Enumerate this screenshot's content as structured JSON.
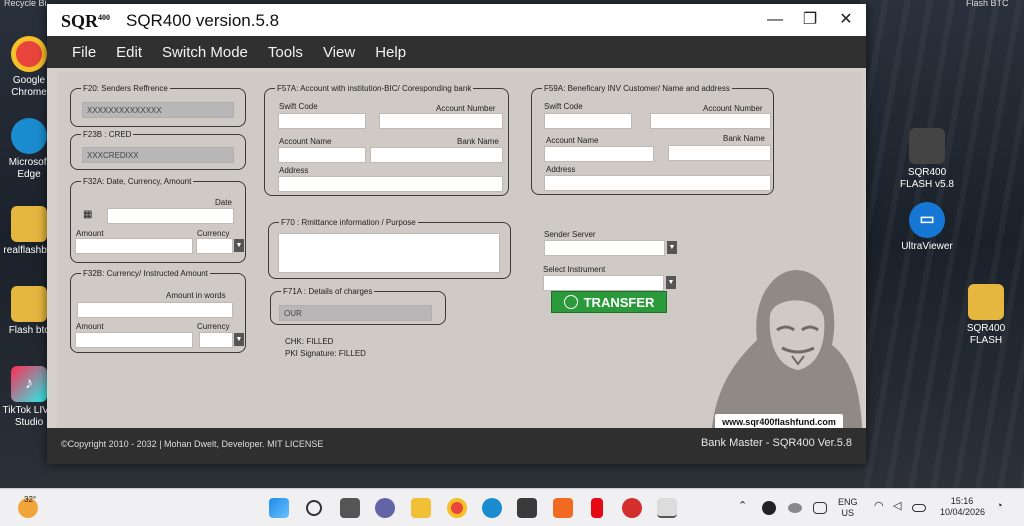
{
  "desktop": {
    "top_left_partial": "Recycle Bi",
    "top_right_partial": "Flash BTC",
    "left_icons": [
      {
        "label": "Google Chrome",
        "color": "#e8453c"
      },
      {
        "label": "Microsoft Edge",
        "color": "#1b8ccf"
      },
      {
        "label": "realflashbtc",
        "color": "#e6b73e"
      },
      {
        "label": "Flash btc",
        "color": "#e6b73e"
      },
      {
        "label": "TikTok LIVE Studio",
        "color": "#111111"
      }
    ],
    "right_icons": [
      {
        "label": "SQR400 FLASH v5.8",
        "color": "#444444"
      },
      {
        "label": "UltraViewer",
        "color": "#1677d4"
      },
      {
        "label": "SQR400 FLASH",
        "color": "#e6b73e"
      }
    ]
  },
  "window": {
    "logo": "SQR",
    "logo_sup": "400",
    "title": "SQR400 version.5.8",
    "controls": {
      "minimize": "—",
      "restore": "❐",
      "close": "✕"
    }
  },
  "menu": [
    "File",
    "Edit",
    "Switch Mode",
    "Tools",
    "View",
    "Help"
  ],
  "form": {
    "f20": {
      "legend": "F20: Senders Reffrence",
      "value": "XXXXXXXXXXXXXX"
    },
    "f23b": {
      "legend": "F23B : CRED",
      "value": "XXXCREDIXX"
    },
    "f32a": {
      "legend": "F32A: Date, Currency, Amount",
      "date_label": "Date",
      "amount_label": "Amount",
      "currency_label": "Currency"
    },
    "f32b": {
      "legend": "F32B: Currency/ Instructed Amount",
      "words_label": "Amount in words",
      "amount_label": "Amount",
      "currency_label": "Currency"
    },
    "f57a": {
      "legend": "F57A: Account with institution-BIC/ Coresponding bank",
      "swift_label": "Swift Code",
      "acct_num_label": "Account Number",
      "acct_name_label": "Account Name",
      "bank_name_label": "Bank Name",
      "address_label": "Address"
    },
    "f59a": {
      "legend": "F59A: Beneficary INV Customer/ Name and address",
      "swift_label": "Swift Code",
      "acct_num_label": "Account Number",
      "acct_name_label": "Account Name",
      "bank_name_label": "Bank Name",
      "address_label": "Address"
    },
    "f70": {
      "legend": "F70 : Rmittance information / Purpose"
    },
    "f71a": {
      "legend": "F71A : Details of charges",
      "value": "OUR"
    },
    "chk": "CHK: FILLED",
    "pki": "PKI Signature: FILLED",
    "sender_server_label": "Sender Server",
    "select_instrument_label": "Select Instrument",
    "transfer_label": "TRANSFER",
    "url": "www.sqr400flashfund.com"
  },
  "status_bar": {
    "copyright": "©Copyright 2010 - 2032 | Mohan Dwelt, Developer. MIT LICENSE",
    "version": "Bank Master - SQR400 Ver.5.8"
  },
  "taskbar": {
    "weather_temp": "32°",
    "lang_top": "ENG",
    "lang_bottom": "US",
    "time": "15:16",
    "date": "10/04/2026"
  }
}
